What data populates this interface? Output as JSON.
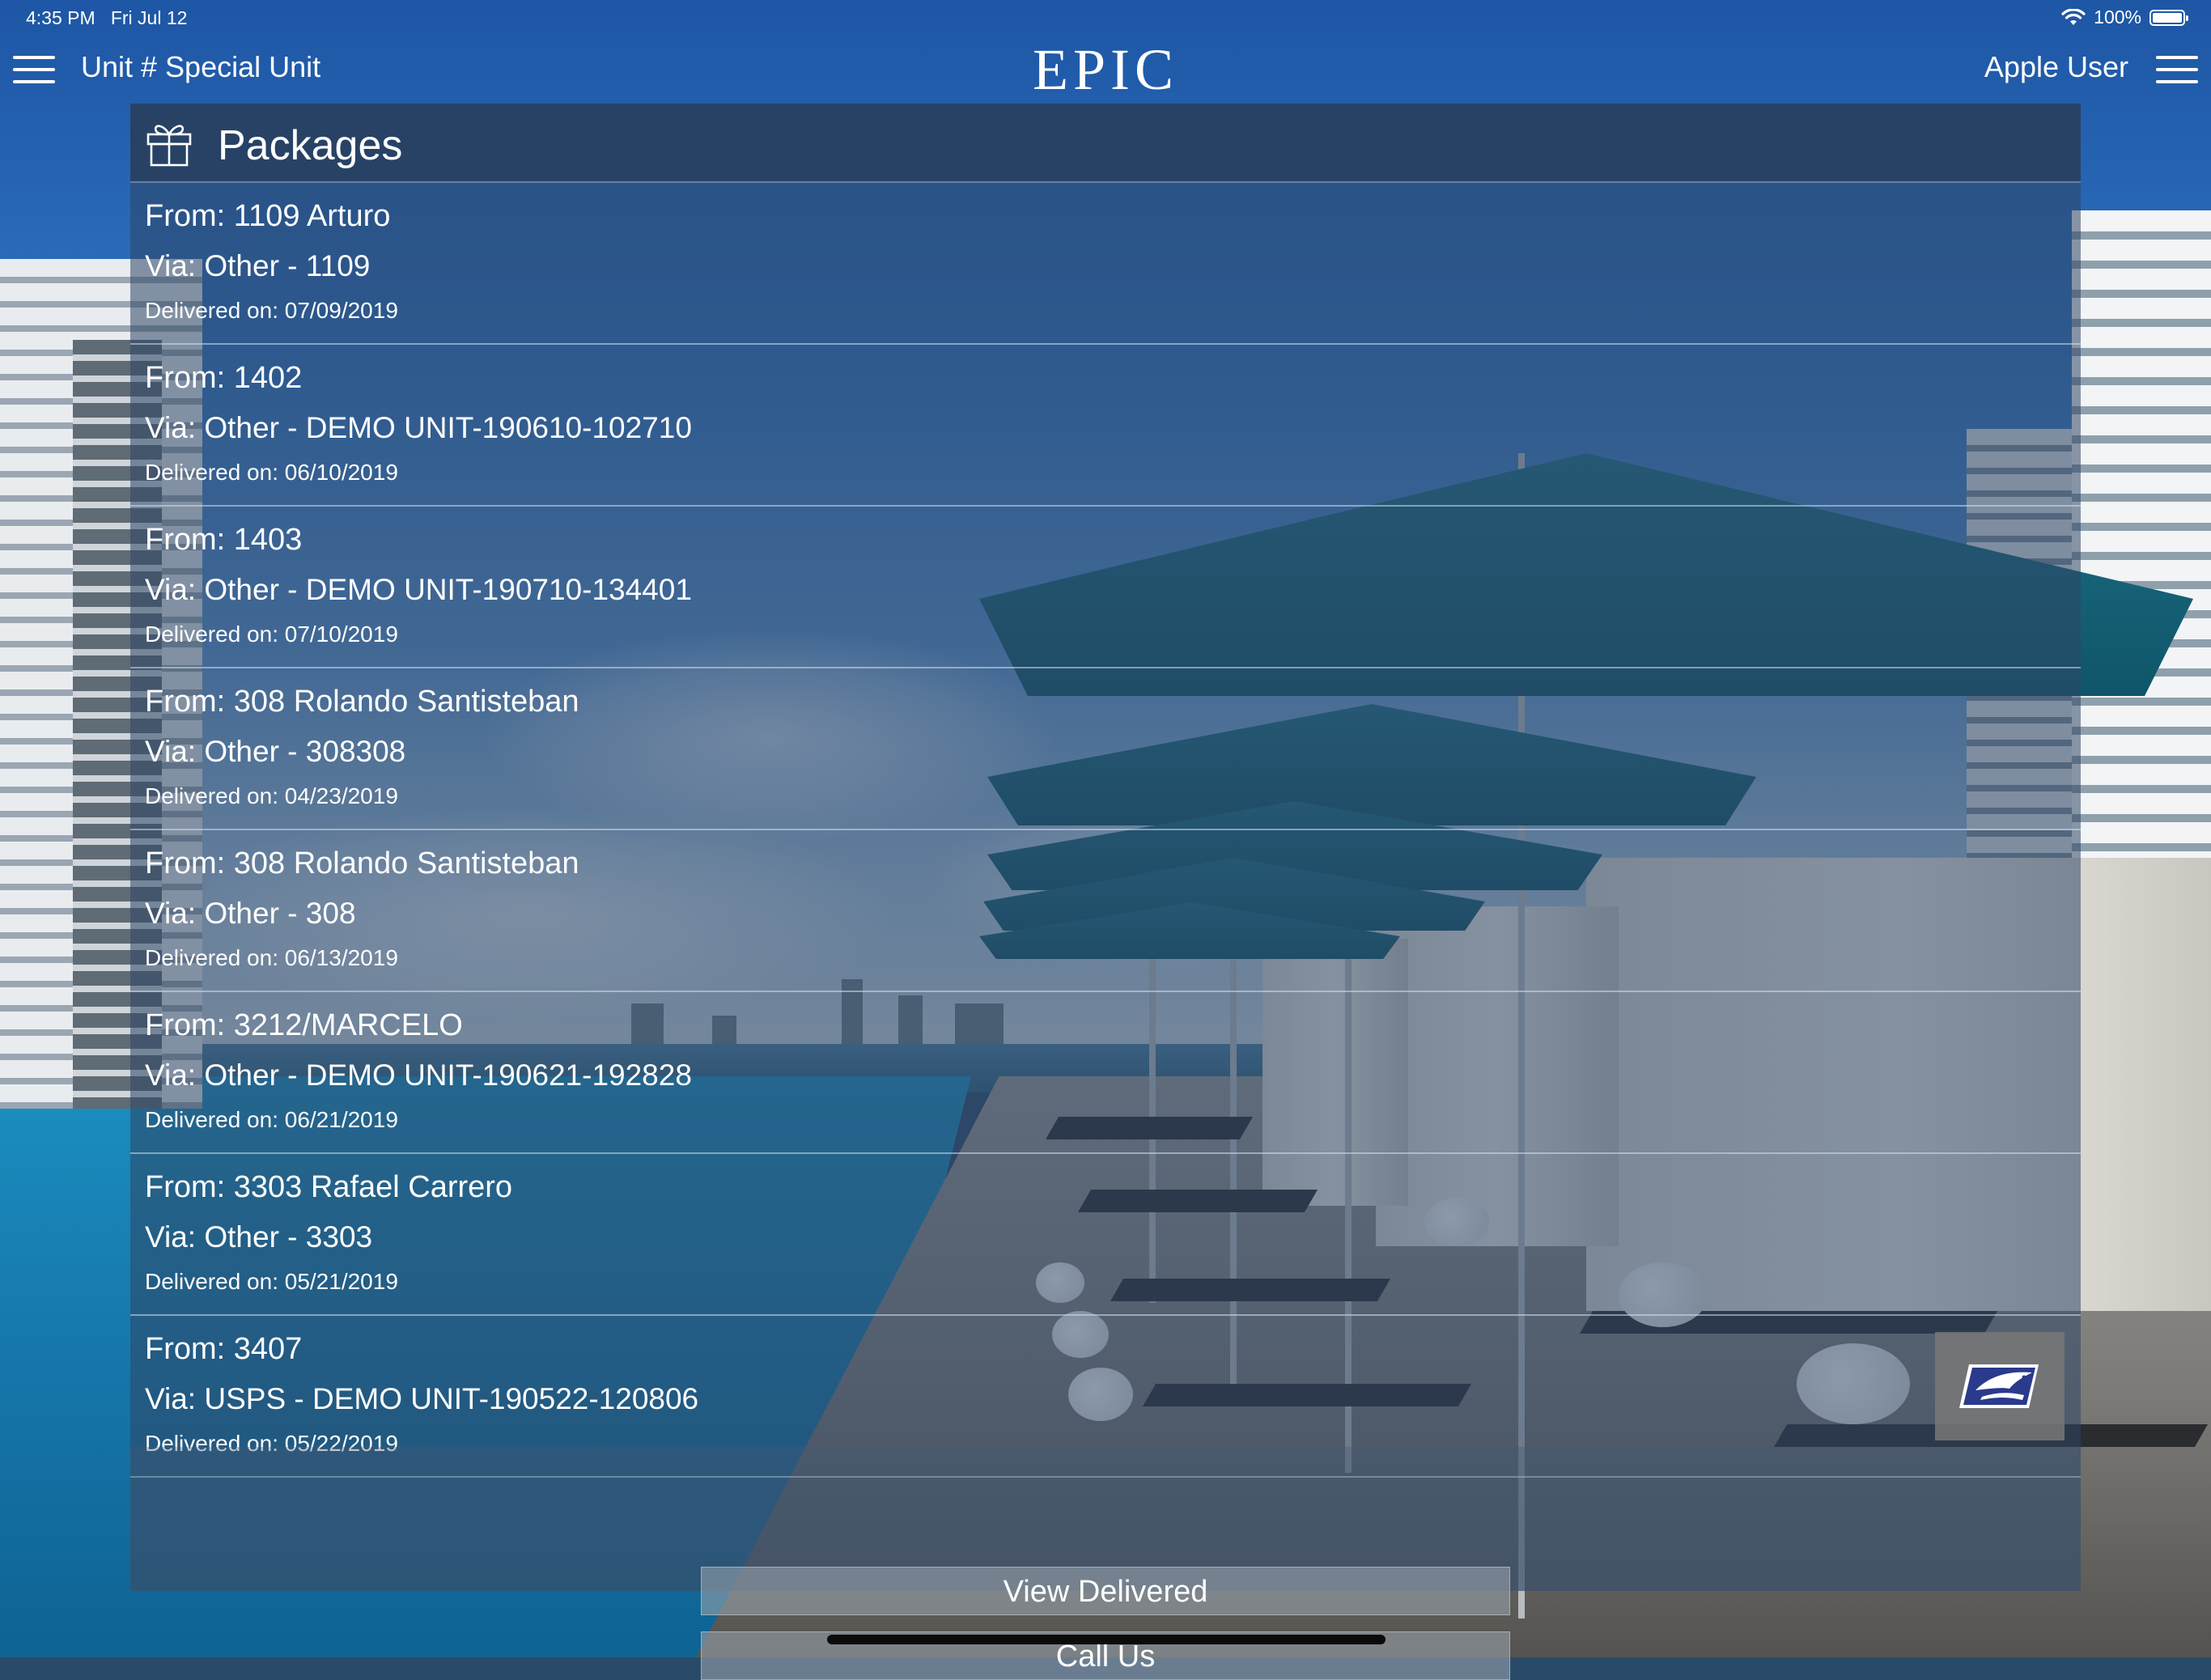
{
  "status_bar": {
    "time": "4:35 PM",
    "date": "Fri Jul 12",
    "battery": "100%",
    "battery_level": 1.0
  },
  "nav": {
    "unit_title": "Unit # Special Unit",
    "logo": "EPIC",
    "user": "Apple User"
  },
  "panel": {
    "title": "Packages",
    "icon": "gift-icon"
  },
  "packages": [
    {
      "from": "From: 1109 Arturo",
      "via": "Via: Other - 1109",
      "delivered": "Delivered on: 07/09/2019"
    },
    {
      "from": "From: 1402",
      "via": "Via: Other - DEMO UNIT-190610-102710",
      "delivered": "Delivered on: 06/10/2019"
    },
    {
      "from": "From: 1403",
      "via": "Via: Other - DEMO UNIT-190710-134401",
      "delivered": "Delivered on: 07/10/2019"
    },
    {
      "from": "From: 308 Rolando Santisteban",
      "via": "Via: Other - 308308",
      "delivered": "Delivered on: 04/23/2019"
    },
    {
      "from": "From: 308 Rolando Santisteban",
      "via": "Via: Other - 308",
      "delivered": "Delivered on: 06/13/2019"
    },
    {
      "from": "From: 3212/MARCELO",
      "via": "Via: Other - DEMO UNIT-190621-192828",
      "delivered": "Delivered on: 06/21/2019"
    },
    {
      "from": "From: 3303 Rafael Carrero",
      "via": "Via: Other - 3303",
      "delivered": "Delivered on: 05/21/2019"
    },
    {
      "from": "From: 3407",
      "via": "Via: USPS - DEMO UNIT-190522-120806",
      "delivered": "Delivered on: 05/22/2019",
      "carrier_icon": "usps-eagle-icon"
    }
  ],
  "actions": {
    "view_delivered": "View Delivered",
    "call_us": "Call Us"
  },
  "colors": {
    "panel_bg": "#2d4664",
    "header_bg": "#283e5c",
    "text": "#ffffff",
    "usps_blue": "#2a3a8c"
  }
}
